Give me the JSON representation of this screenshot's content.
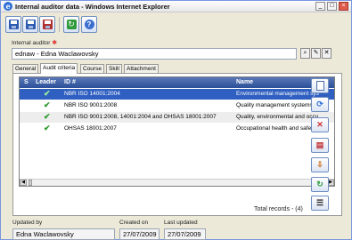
{
  "window": {
    "title": "Internal auditor data - Windows Internet Explorer",
    "minimize": "_",
    "maximize": "□",
    "close": "×"
  },
  "toolbar": {
    "save_icon": "save-icon",
    "save_new_icon": "save-new-icon",
    "save_close_icon": "save-close-icon",
    "refresh_icon": "refresh-icon",
    "help_glyph": "?"
  },
  "auditor": {
    "label": "Internal auditor",
    "required_mark": "✱",
    "value": "ednaw - Edna Waclawovsky"
  },
  "tabs": [
    "General",
    "Audit criteria",
    "Course",
    "Skill",
    "Attachment"
  ],
  "active_tab": "Audit criteria",
  "grid": {
    "columns": [
      "S",
      "Leader",
      "ID #",
      "Name"
    ],
    "rows": [
      {
        "leader": "✔",
        "id": "NBR ISO 14001:2004",
        "name": "Environmental management sys",
        "selected": true
      },
      {
        "leader": "✔",
        "id": "NBR ISO 9001:2008",
        "name": "Quality management systems -",
        "selected": false
      },
      {
        "leader": "✔",
        "id": "NBR ISO 9001:2008, 14001:2004 and OHSAS 18001:2007",
        "name": "Quality, environmental and occu",
        "selected": false
      },
      {
        "leader": "✔",
        "id": "OHSAS 18001:2007",
        "name": "Occupational health and safety",
        "selected": false
      }
    ],
    "total_records": "Total records - (4)"
  },
  "footer": {
    "updated_by_label": "Updated by",
    "updated_by_value": "Edna Waclawovsky",
    "created_on_label": "Created on",
    "created_on_value": "27/07/2009",
    "last_updated_label": "Last updated",
    "last_updated_value": "27/07/2009"
  },
  "colors": {
    "header": "#2b4f98",
    "selected_row": "#2f5fc0",
    "check": "#2c9b2c"
  }
}
